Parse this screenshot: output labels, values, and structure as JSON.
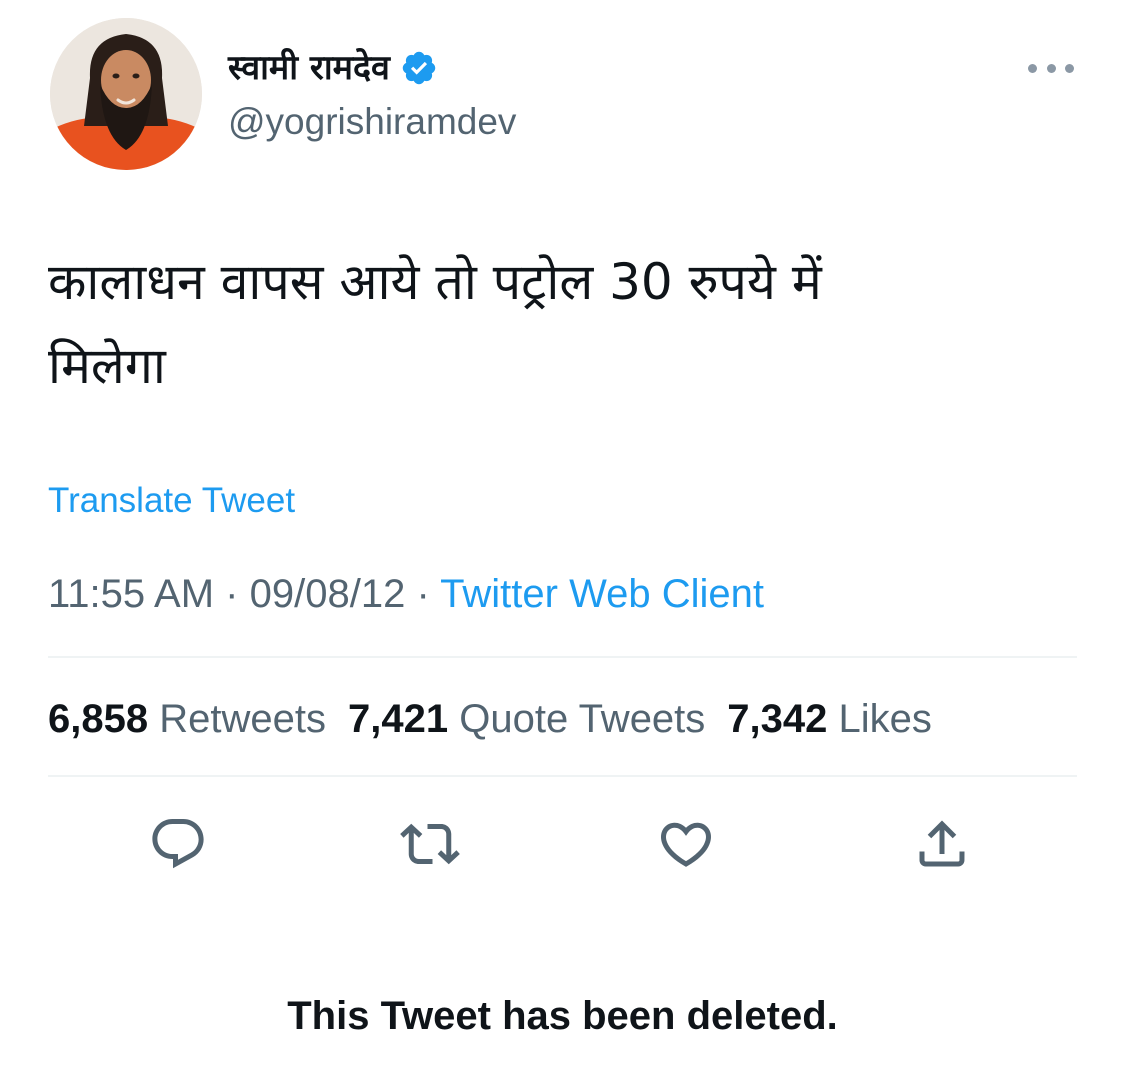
{
  "author": {
    "display_name": "स्वामी रामदेव",
    "handle": "@yogrishiramdev",
    "verified": true,
    "avatar_icon": "profile-photo"
  },
  "tweet": {
    "text_line1": "कालाधन वापस आये तो पट्रोल 30 रुपये में",
    "text_line2": "मिलेगा",
    "translate_label": "Translate Tweet",
    "time": "11:55 AM",
    "date": "09/08/12",
    "separator": "·",
    "source": "Twitter Web Client"
  },
  "stats": {
    "retweets_count": "6,858",
    "retweets_label": "Retweets",
    "quotes_count": "7,421",
    "quotes_label": "Quote Tweets",
    "likes_count": "7,342",
    "likes_label": "Likes"
  },
  "actions": [
    "reply-icon",
    "retweet-icon",
    "like-icon",
    "share-icon"
  ],
  "notice": "This Tweet has been deleted.",
  "colors": {
    "accent": "#1d9bf0",
    "text": "#0f1419",
    "muted": "#536471",
    "divider": "#eff3f4"
  }
}
